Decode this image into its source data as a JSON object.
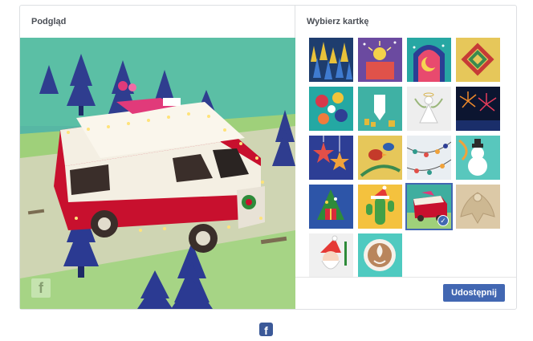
{
  "preview": {
    "title": "Podgląd",
    "watermark_icon": "facebook-f-icon",
    "scene": "paper-craft camper van with christmas tree and lights"
  },
  "picker": {
    "title": "Wybierz kartkę",
    "cards": [
      {
        "id": "forest",
        "bg": "#1e3d6e",
        "accent": "#e8c13a"
      },
      {
        "id": "sparkle",
        "bg": "#6b4aa0",
        "accent": "#f4d24a"
      },
      {
        "id": "lantern-moon",
        "bg": "#27a7a3",
        "accent": "#2a3f94"
      },
      {
        "id": "knot-pattern",
        "bg": "#e6c75a",
        "accent": "#c63a36"
      },
      {
        "id": "ornaments-wreath",
        "bg": "#24a8a3",
        "accent": "#d8384a"
      },
      {
        "id": "dreidel",
        "bg": "#3fb1a4",
        "accent": "#e4b93a"
      },
      {
        "id": "angel",
        "bg": "#eeeeee",
        "accent": "#9ab67a"
      },
      {
        "id": "fireworks",
        "bg": "#0c1530",
        "accent": "#f08a2a"
      },
      {
        "id": "stars",
        "bg": "#2d3e95",
        "accent": "#e14f48"
      },
      {
        "id": "birds",
        "bg": "#e6c75a",
        "accent": "#c43a2a"
      },
      {
        "id": "lights-string",
        "bg": "#e9eef2",
        "accent": "#2f9a8c"
      },
      {
        "id": "snowman",
        "bg": "#58c7bd",
        "accent": "#ffffff"
      },
      {
        "id": "gift-tree",
        "bg": "#2d55a8",
        "accent": "#d92b3a"
      },
      {
        "id": "cactus-santa",
        "bg": "#f4c23e",
        "accent": "#43a047"
      },
      {
        "id": "camper-van",
        "bg": "#3fae9f",
        "accent": "#c8102e"
      },
      {
        "id": "sand-angel",
        "bg": "#dcc9a7",
        "accent": "#b49c77"
      },
      {
        "id": "santa-drawing",
        "bg": "#f0f0f0",
        "accent": "#e53935"
      },
      {
        "id": "latte-art",
        "bg": "#4fcac0",
        "accent": "#f6f1ea"
      }
    ],
    "selected_index": 14,
    "share_label": "Udostępnij"
  },
  "footer": {
    "icon": "facebook-f-icon",
    "glyph": "f"
  }
}
